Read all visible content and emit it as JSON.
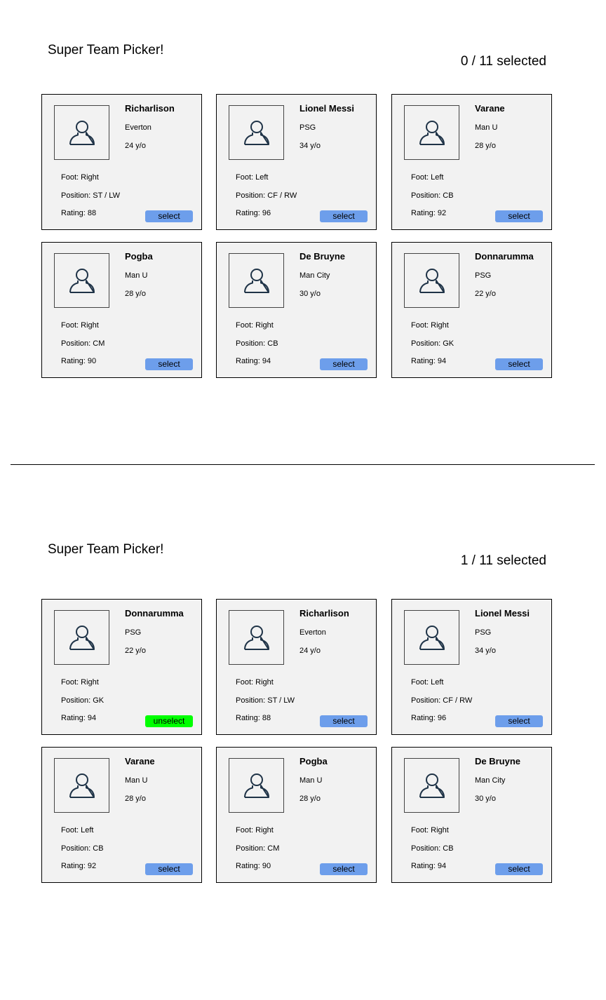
{
  "colors": {
    "card_background": "#f2f2f2",
    "select_button": "#6d9eeb",
    "unselect_button": "#00ff00"
  },
  "screens": [
    {
      "title": "Super Team Picker!",
      "counter": "0 / 11 selected",
      "cards": [
        {
          "name": "Richarlison",
          "club": "Everton",
          "age": "24 y/o",
          "foot": "Foot: Right",
          "position": "Position: ST / LW",
          "rating": "Rating: 88",
          "button_label": "select",
          "selected": false,
          "icon": "person-icon"
        },
        {
          "name": "Lionel Messi",
          "club": "PSG",
          "age": "34 y/o",
          "foot": "Foot: Left",
          "position": "Position: CF / RW",
          "rating": "Rating: 96",
          "button_label": "select",
          "selected": false,
          "icon": "person-icon"
        },
        {
          "name": "Varane",
          "club": "Man U",
          "age": "28 y/o",
          "foot": "Foot: Left",
          "position": "Position: CB",
          "rating": "Rating: 92",
          "button_label": "select",
          "selected": false,
          "icon": "person-icon"
        },
        {
          "name": "Pogba",
          "club": "Man U",
          "age": "28 y/o",
          "foot": "Foot: Right",
          "position": "Position: CM",
          "rating": "Rating: 90",
          "button_label": "select",
          "selected": false,
          "icon": "person-icon"
        },
        {
          "name": "De Bruyne",
          "club": "Man City",
          "age": "30 y/o",
          "foot": "Foot: Right",
          "position": "Position: CB",
          "rating": "Rating: 94",
          "button_label": "select",
          "selected": false,
          "icon": "person-icon"
        },
        {
          "name": "Donnarumma",
          "club": "PSG",
          "age": "22 y/o",
          "foot": "Foot: Right",
          "position": "Position: GK",
          "rating": "Rating: 94",
          "button_label": "select",
          "selected": false,
          "icon": "person-icon"
        }
      ]
    },
    {
      "title": "Super Team Picker!",
      "counter": "1 / 11 selected",
      "cards": [
        {
          "name": "Donnarumma",
          "club": "PSG",
          "age": "22 y/o",
          "foot": "Foot: Right",
          "position": "Position: GK",
          "rating": "Rating: 94",
          "button_label": "unselect",
          "selected": true,
          "icon": "person-icon"
        },
        {
          "name": "Richarlison",
          "club": "Everton",
          "age": "24 y/o",
          "foot": "Foot: Right",
          "position": "Position: ST / LW",
          "rating": "Rating: 88",
          "button_label": "select",
          "selected": false,
          "icon": "person-icon"
        },
        {
          "name": "Lionel Messi",
          "club": "PSG",
          "age": "34 y/o",
          "foot": "Foot: Left",
          "position": "Position: CF / RW",
          "rating": "Rating: 96",
          "button_label": "select",
          "selected": false,
          "icon": "person-icon"
        },
        {
          "name": "Varane",
          "club": "Man U",
          "age": "28 y/o",
          "foot": "Foot: Left",
          "position": "Position: CB",
          "rating": "Rating: 92",
          "button_label": "select",
          "selected": false,
          "icon": "person-icon"
        },
        {
          "name": "Pogba",
          "club": "Man U",
          "age": "28 y/o",
          "foot": "Foot: Right",
          "position": "Position: CM",
          "rating": "Rating: 90",
          "button_label": "select",
          "selected": false,
          "icon": "person-icon"
        },
        {
          "name": "De Bruyne",
          "club": "Man City",
          "age": "30 y/o",
          "foot": "Foot: Right",
          "position": "Position: CB",
          "rating": "Rating: 94",
          "button_label": "select",
          "selected": false,
          "icon": "person-icon"
        }
      ]
    }
  ]
}
